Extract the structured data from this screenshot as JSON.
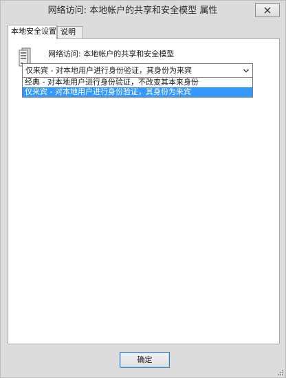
{
  "window": {
    "title": "网络访问: 本地帐户的共享和安全模型 属性"
  },
  "tabs": [
    {
      "label": "本地安全设置",
      "active": true
    },
    {
      "label": "说明",
      "active": false
    }
  ],
  "panel": {
    "policy_icon": "server-icon",
    "policy_name": "网络访问: 本地帐户的共享和安全模型"
  },
  "dropdown": {
    "selected": "仅来宾 - 对本地用户进行身份验证，其身份为来宾",
    "options": [
      "经典 - 对本地用户进行身份验证，不改变其本来身份",
      "仅来宾 - 对本地用户进行身份验证，其身份为来宾"
    ],
    "highlighted_index": 1
  },
  "footer": {
    "ok_label": "确定"
  },
  "colors": {
    "selection": "#3399ff",
    "window_bg": "#dcdcdc",
    "panel_bg": "#ffffff"
  }
}
